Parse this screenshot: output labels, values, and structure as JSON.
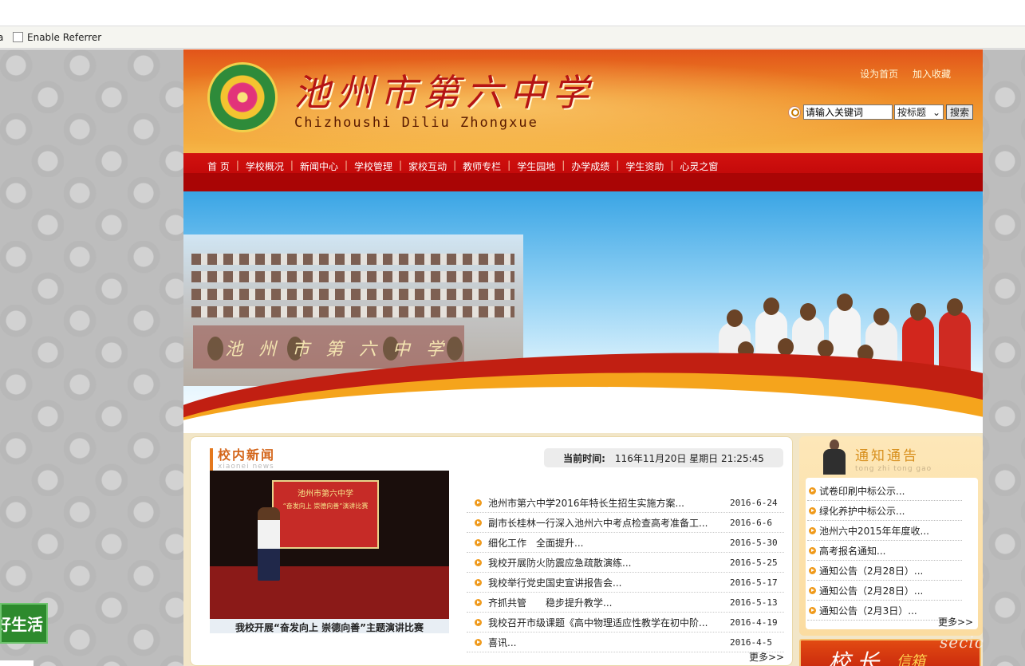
{
  "browser": {
    "referrer_label": "Enable Referrer",
    "cut_text": "a"
  },
  "side_ad": {
    "text": "好生活"
  },
  "header": {
    "title": "池州市第六中学",
    "subtitle": "Chizhoushi Diliu Zhongxue",
    "links": [
      "设为首页",
      "加入收藏"
    ],
    "search": {
      "value": "请输入关键词",
      "select_value": "按标题",
      "button": "搜索"
    }
  },
  "nav": {
    "items": [
      "首 页",
      "学校概况",
      "新闻中心",
      "学校管理",
      "家校互动",
      "教师专栏",
      "学生园地",
      "办学成绩",
      "学生资助",
      "心灵之窗"
    ],
    "separator": "|"
  },
  "banner": {
    "sign_text": "池州市第六中学"
  },
  "news": {
    "heading": "校内新闻",
    "heading_pinyin": "xiaonei news",
    "time_label": "当前时间:",
    "time_value": "116年11月20日 星期日 21:25:45",
    "photo_banner": "池州市第六中学",
    "photo_banner2": "“奋发向上 崇德向善”演讲比赛",
    "photo_caption": "我校开展“奋发向上 崇德向善”主题演讲比赛",
    "items": [
      {
        "title": "池州市第六中学2016年特长生招生实施方案...",
        "date": "2016-6-24"
      },
      {
        "title": "副市长桂林一行深入池州六中考点检查高考准备工...",
        "date": "2016-6-6"
      },
      {
        "title": "细化工作　全面提升...",
        "date": "2016-5-30"
      },
      {
        "title": "我校开展防火防震应急疏散演练...",
        "date": "2016-5-25"
      },
      {
        "title": "我校举行党史国史宣讲报告会...",
        "date": "2016-5-17"
      },
      {
        "title": "齐抓共管　　稳步提升教学...",
        "date": "2016-5-13"
      },
      {
        "title": "我校召开市级课题《高中物理适应性教学在初中阶...",
        "date": "2016-4-19"
      },
      {
        "title": "喜讯...",
        "date": "2016-4-5"
      }
    ],
    "more": "更多>>"
  },
  "notice": {
    "heading": "通知通告",
    "heading_pinyin": "tong zhi tong gao",
    "items": [
      "试卷印刷中标公示...",
      "绿化养护中标公示...",
      "池州六中2015年年度收...",
      "高考报名通知...",
      "通知公告（2月28日）...",
      "通知公告（2月28日）...",
      "通知公告（2月3日）..."
    ],
    "more": "更多>>"
  },
  "principal": {
    "title": "校长",
    "title2": "信箱"
  },
  "watermark": "secic"
}
